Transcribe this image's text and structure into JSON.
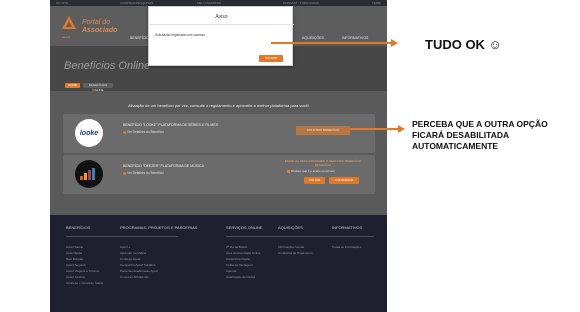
{
  "top_strip": [
    "NO SITE",
    "COMPRAS/PESQUISAS",
    "MEU CADASTRO",
    "PODCAST / TUDO ASSOC",
    "TERM"
  ],
  "logo": {
    "line1": "Portal do",
    "line2": "Associado",
    "sub": "apcef"
  },
  "nav": [
    "BENEFÍCIOS",
    "AQUISIÇÕES",
    "INFORMATIVOS"
  ],
  "hero": {
    "title": "Benefícios Online",
    "crumb_home": "HOME",
    "crumb_current": "BENEFÍCIOS ONLINE"
  },
  "content": {
    "intro": "Aliviação de um benefício por vez, consulte o regulamento e aproveite a melhor plataforma para você!",
    "card1": {
      "logo": "looke",
      "title": "BENEFÍCIO \"LOOKE\" PLATAFORMA DE SÉRIES E FILMES",
      "link": "Ver Detalhes do Benefício",
      "button": "SOLICITAR BENEFÍCIO"
    },
    "card2": {
      "logo": "deezer",
      "title": "BENEFÍCIO \"DEEZER\" PLATAFORMA DE MÚSICA",
      "link": "Ver Detalhes do Benefício",
      "choose": "ESCOLHA PARA ESCOLHER O SEGUNDO BENEFÍCIO BENEFÍCIO",
      "checkbox": "Declaro que li e aceito os termos",
      "voltar": "VOLTAR",
      "confirmar": "CONFIRMAR"
    }
  },
  "footer": {
    "columns": [
      {
        "head": "BENEFÍCIOS",
        "links": [
          "Apcef Saúde",
          "Apcef Bolsa",
          "Bem Estudar",
          "Apcef Seguros",
          "Apcef Viagens e Turismo",
          "Apcef Jurídico",
          "Conheça o Convênio Saúde"
        ]
      },
      {
        "head": "PROGRAMAS, PROJETOS E PARCERIAS",
        "links": [
          "Apcef +",
          "Aprender na Melhor",
          "Conheça Apcef",
          "Campanha Apcef Solidária",
          "Parcerias Acadêmicas Apcef",
          "Concurso APCEF-SC"
        ]
      },
      {
        "head": "SERVIÇOS ONLINE",
        "links": [
          "2ª Via de Boleto",
          "Área do Associado Online",
          "Carteirinha Digital",
          "Clube de Vantagens",
          "Agenda",
          "Atualização de Dados"
        ]
      },
      {
        "head": "AQUISIÇÕES",
        "links": [
          "Informações Gerais",
          "Condições de Pagamento"
        ]
      },
      {
        "head": "INFORMATIVOS",
        "links": [
          "Todas as Informações"
        ]
      }
    ]
  },
  "modal": {
    "title": "Aviso",
    "message": "Solicitação registrada com sucesso",
    "close": "FECHAR"
  },
  "annotations": {
    "ok": "TUDO OK ☺",
    "note": "PERCEBA QUE A OUTRA OPÇÃO FICARÁ DESABILITADA AUTOMATICAMENTE"
  },
  "colors": {
    "accent": "#e07a2a",
    "footer_bg": "#1e2030"
  }
}
